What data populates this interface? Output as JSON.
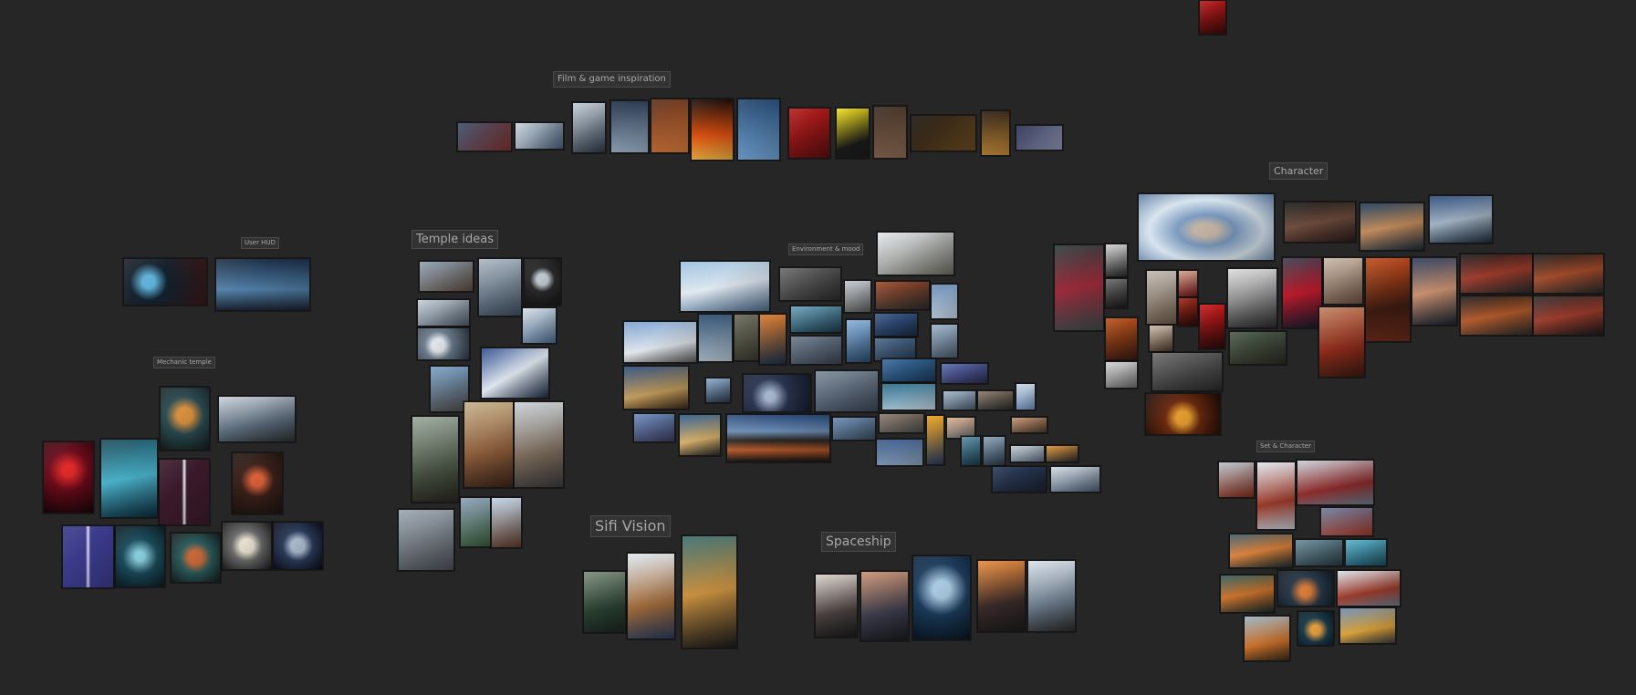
{
  "canvas": {
    "background": "#262626"
  },
  "groups": [
    {
      "id": "film",
      "label": "Film & game inspiration"
    },
    {
      "id": "user-hud",
      "label": "User HUD"
    },
    {
      "id": "temple",
      "label": "Temple ideas"
    },
    {
      "id": "environment",
      "label": "Environment & mood"
    },
    {
      "id": "character",
      "label": "Character"
    },
    {
      "id": "mechanic",
      "label": "Mechanic temple"
    },
    {
      "id": "set-character",
      "label": "Set & Character"
    },
    {
      "id": "sifi",
      "label": "Sifi Vision"
    },
    {
      "id": "spaceship",
      "label": "Spaceship"
    }
  ],
  "palette": {
    "snow": "#b9c4cf",
    "ice": "#4f7ea6",
    "night": "#1d2f45",
    "fire": "#b8421e",
    "ember": "#d9892b",
    "red": "#9c1f1f",
    "yellow": "#e8d21a",
    "stone": "#6b6a66",
    "dark": "#2a2522",
    "teal": "#2b7083",
    "violet": "#4b3a8c",
    "rust": "#7a3b1c",
    "skin": "#8a5a44",
    "forest": "#3f5a3a",
    "steel": "#59687a"
  }
}
